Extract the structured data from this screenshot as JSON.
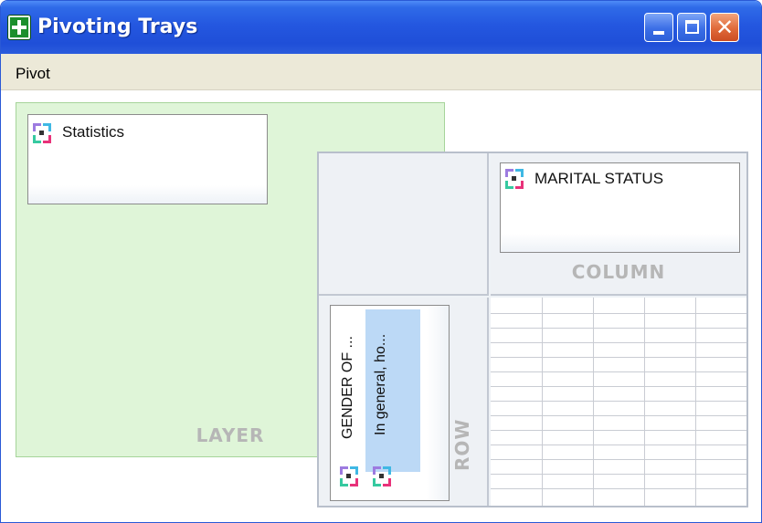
{
  "window": {
    "title": "Pivoting Trays",
    "controls": {
      "minimize": "minimize-icon",
      "maximize": "maximize-icon",
      "close": "close-icon",
      "close_glyph": "✕"
    }
  },
  "menu": {
    "items": [
      "Pivot"
    ]
  },
  "layer": {
    "title": "LAYER",
    "items": [
      {
        "label": "Statistics",
        "icon": "variable-icon"
      }
    ]
  },
  "column": {
    "title": "COLUMN",
    "items": [
      {
        "label": "MARITAL STATUS",
        "icon": "variable-icon"
      }
    ]
  },
  "row": {
    "title": "ROW",
    "items": [
      {
        "label": "GENDER OF ...",
        "icon": "variable-icon"
      },
      {
        "label": "In general, ho...",
        "icon": "variable-icon",
        "selected": true
      }
    ]
  },
  "colors": {
    "titlebar": "#2457e0",
    "layer_background": "#dff5d8",
    "selected_item": "#bcd9f6",
    "tray_title": "#b6b6b6"
  }
}
